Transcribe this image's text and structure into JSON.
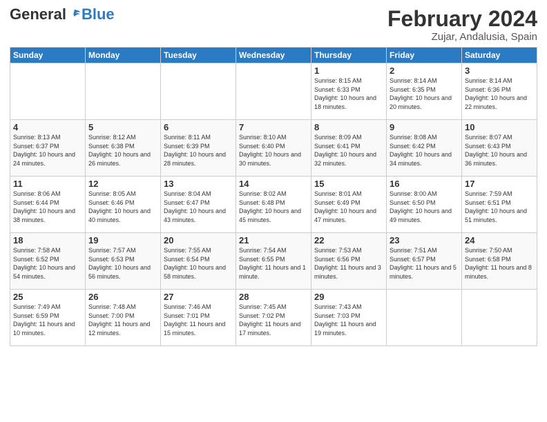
{
  "header": {
    "logo_general": "General",
    "logo_blue": "Blue",
    "month_title": "February 2024",
    "location": "Zujar, Andalusia, Spain"
  },
  "days_of_week": [
    "Sunday",
    "Monday",
    "Tuesday",
    "Wednesday",
    "Thursday",
    "Friday",
    "Saturday"
  ],
  "weeks": [
    [
      {
        "day": "",
        "info": ""
      },
      {
        "day": "",
        "info": ""
      },
      {
        "day": "",
        "info": ""
      },
      {
        "day": "",
        "info": ""
      },
      {
        "day": "1",
        "info": "Sunrise: 8:15 AM\nSunset: 6:33 PM\nDaylight: 10 hours\nand 18 minutes."
      },
      {
        "day": "2",
        "info": "Sunrise: 8:14 AM\nSunset: 6:35 PM\nDaylight: 10 hours\nand 20 minutes."
      },
      {
        "day": "3",
        "info": "Sunrise: 8:14 AM\nSunset: 6:36 PM\nDaylight: 10 hours\nand 22 minutes."
      }
    ],
    [
      {
        "day": "4",
        "info": "Sunrise: 8:13 AM\nSunset: 6:37 PM\nDaylight: 10 hours\nand 24 minutes."
      },
      {
        "day": "5",
        "info": "Sunrise: 8:12 AM\nSunset: 6:38 PM\nDaylight: 10 hours\nand 26 minutes."
      },
      {
        "day": "6",
        "info": "Sunrise: 8:11 AM\nSunset: 6:39 PM\nDaylight: 10 hours\nand 28 minutes."
      },
      {
        "day": "7",
        "info": "Sunrise: 8:10 AM\nSunset: 6:40 PM\nDaylight: 10 hours\nand 30 minutes."
      },
      {
        "day": "8",
        "info": "Sunrise: 8:09 AM\nSunset: 6:41 PM\nDaylight: 10 hours\nand 32 minutes."
      },
      {
        "day": "9",
        "info": "Sunrise: 8:08 AM\nSunset: 6:42 PM\nDaylight: 10 hours\nand 34 minutes."
      },
      {
        "day": "10",
        "info": "Sunrise: 8:07 AM\nSunset: 6:43 PM\nDaylight: 10 hours\nand 36 minutes."
      }
    ],
    [
      {
        "day": "11",
        "info": "Sunrise: 8:06 AM\nSunset: 6:44 PM\nDaylight: 10 hours\nand 38 minutes."
      },
      {
        "day": "12",
        "info": "Sunrise: 8:05 AM\nSunset: 6:46 PM\nDaylight: 10 hours\nand 40 minutes."
      },
      {
        "day": "13",
        "info": "Sunrise: 8:04 AM\nSunset: 6:47 PM\nDaylight: 10 hours\nand 43 minutes."
      },
      {
        "day": "14",
        "info": "Sunrise: 8:02 AM\nSunset: 6:48 PM\nDaylight: 10 hours\nand 45 minutes."
      },
      {
        "day": "15",
        "info": "Sunrise: 8:01 AM\nSunset: 6:49 PM\nDaylight: 10 hours\nand 47 minutes."
      },
      {
        "day": "16",
        "info": "Sunrise: 8:00 AM\nSunset: 6:50 PM\nDaylight: 10 hours\nand 49 minutes."
      },
      {
        "day": "17",
        "info": "Sunrise: 7:59 AM\nSunset: 6:51 PM\nDaylight: 10 hours\nand 51 minutes."
      }
    ],
    [
      {
        "day": "18",
        "info": "Sunrise: 7:58 AM\nSunset: 6:52 PM\nDaylight: 10 hours\nand 54 minutes."
      },
      {
        "day": "19",
        "info": "Sunrise: 7:57 AM\nSunset: 6:53 PM\nDaylight: 10 hours\nand 56 minutes."
      },
      {
        "day": "20",
        "info": "Sunrise: 7:55 AM\nSunset: 6:54 PM\nDaylight: 10 hours\nand 58 minutes."
      },
      {
        "day": "21",
        "info": "Sunrise: 7:54 AM\nSunset: 6:55 PM\nDaylight: 11 hours\nand 1 minute."
      },
      {
        "day": "22",
        "info": "Sunrise: 7:53 AM\nSunset: 6:56 PM\nDaylight: 11 hours\nand 3 minutes."
      },
      {
        "day": "23",
        "info": "Sunrise: 7:51 AM\nSunset: 6:57 PM\nDaylight: 11 hours\nand 5 minutes."
      },
      {
        "day": "24",
        "info": "Sunrise: 7:50 AM\nSunset: 6:58 PM\nDaylight: 11 hours\nand 8 minutes."
      }
    ],
    [
      {
        "day": "25",
        "info": "Sunrise: 7:49 AM\nSunset: 6:59 PM\nDaylight: 11 hours\nand 10 minutes."
      },
      {
        "day": "26",
        "info": "Sunrise: 7:48 AM\nSunset: 7:00 PM\nDaylight: 11 hours\nand 12 minutes."
      },
      {
        "day": "27",
        "info": "Sunrise: 7:46 AM\nSunset: 7:01 PM\nDaylight: 11 hours\nand 15 minutes."
      },
      {
        "day": "28",
        "info": "Sunrise: 7:45 AM\nSunset: 7:02 PM\nDaylight: 11 hours\nand 17 minutes."
      },
      {
        "day": "29",
        "info": "Sunrise: 7:43 AM\nSunset: 7:03 PM\nDaylight: 11 hours\nand 19 minutes."
      },
      {
        "day": "",
        "info": ""
      },
      {
        "day": "",
        "info": ""
      }
    ]
  ]
}
